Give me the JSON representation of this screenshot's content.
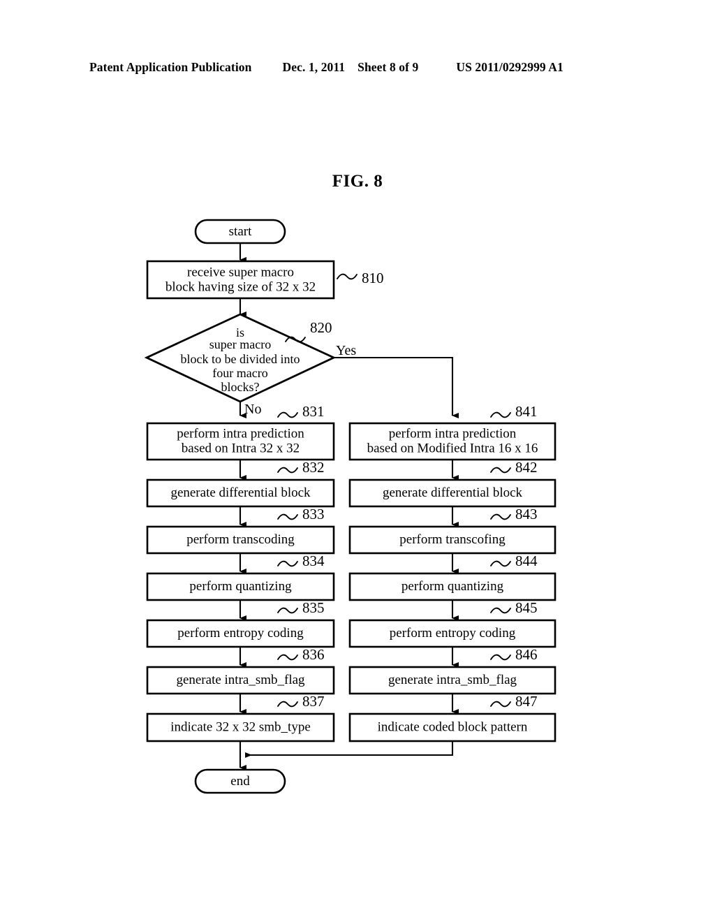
{
  "header": {
    "publication": "Patent Application Publication",
    "date": "Dec. 1, 2011",
    "sheet": "Sheet 8 of 9",
    "patent_number": "US 2011/0292999 A1"
  },
  "figure": {
    "title": "FIG. 8"
  },
  "flowchart": {
    "start_label": "start",
    "end_label": "end",
    "branch_yes": "Yes",
    "branch_no": "No",
    "nodes": {
      "n810": {
        "ref": "810",
        "lines": [
          "receive super macro",
          "block having size of 32 x 32"
        ]
      },
      "n820": {
        "ref": "820",
        "lines": [
          "is",
          "super macro",
          "block to be divided into",
          "four macro",
          "blocks?"
        ]
      },
      "n831": {
        "ref": "831",
        "lines": [
          "perform intra prediction",
          "based on Intra 32 x 32"
        ]
      },
      "n832": {
        "ref": "832",
        "lines": [
          "generate differential block"
        ]
      },
      "n833": {
        "ref": "833",
        "lines": [
          "perform transcoding"
        ]
      },
      "n834": {
        "ref": "834",
        "lines": [
          "perform quantizing"
        ]
      },
      "n835": {
        "ref": "835",
        "lines": [
          "perform entropy coding"
        ]
      },
      "n836": {
        "ref": "836",
        "lines": [
          "generate intra_smb_flag"
        ]
      },
      "n837": {
        "ref": "837",
        "lines": [
          "indicate 32 x 32 smb_type"
        ]
      },
      "n841": {
        "ref": "841",
        "lines": [
          "perform intra prediction",
          "based on Modified Intra 16 x 16"
        ]
      },
      "n842": {
        "ref": "842",
        "lines": [
          "generate differential block"
        ]
      },
      "n843": {
        "ref": "843",
        "lines": [
          "perform transcofing"
        ]
      },
      "n844": {
        "ref": "844",
        "lines": [
          "perform quantizing"
        ]
      },
      "n845": {
        "ref": "845",
        "lines": [
          "perform entropy coding"
        ]
      },
      "n846": {
        "ref": "846",
        "lines": [
          "generate intra_smb_flag"
        ]
      },
      "n847": {
        "ref": "847",
        "lines": [
          "indicate coded block pattern"
        ]
      }
    }
  },
  "colors": {
    "ink": "#000000",
    "paper": "#ffffff"
  }
}
